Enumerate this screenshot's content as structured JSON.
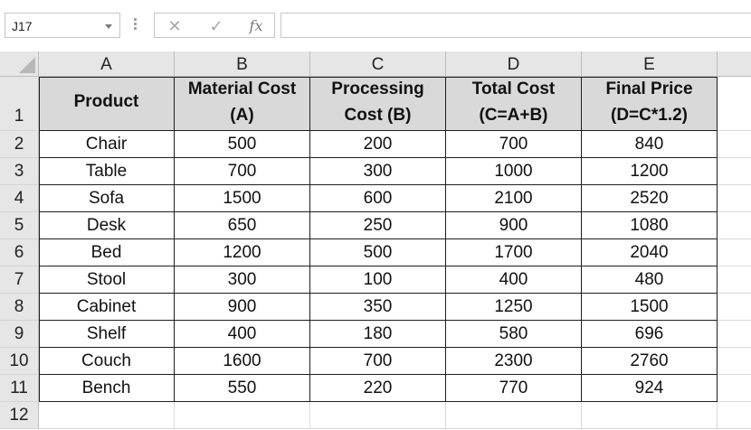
{
  "formula_bar": {
    "name_box": "J17",
    "cancel_glyph": "✕",
    "enter_glyph": "✓",
    "function_glyph": "fx",
    "formula": ""
  },
  "columns": [
    "A",
    "B",
    "C",
    "D",
    "E"
  ],
  "row_numbers": [
    "1",
    "2",
    "3",
    "4",
    "5",
    "6",
    "7",
    "8",
    "9",
    "10",
    "11",
    "12"
  ],
  "headers": [
    {
      "line1": "Product",
      "line2": ""
    },
    {
      "line1": "Material Cost",
      "line2": "(A)"
    },
    {
      "line1": "Processing",
      "line2": "Cost (B)"
    },
    {
      "line1": "Total Cost",
      "line2": "(C=A+B)"
    },
    {
      "line1": "Final Price",
      "line2": "(D=C*1.2)"
    }
  ],
  "rows": [
    [
      "Chair",
      "500",
      "200",
      "700",
      "840"
    ],
    [
      "Table",
      "700",
      "300",
      "1000",
      "1200"
    ],
    [
      "Sofa",
      "1500",
      "600",
      "2100",
      "2520"
    ],
    [
      "Desk",
      "650",
      "250",
      "900",
      "1080"
    ],
    [
      "Bed",
      "1200",
      "500",
      "1700",
      "2040"
    ],
    [
      "Stool",
      "300",
      "100",
      "400",
      "480"
    ],
    [
      "Cabinet",
      "900",
      "350",
      "1250",
      "1500"
    ],
    [
      "Shelf",
      "400",
      "180",
      "580",
      "696"
    ],
    [
      "Couch",
      "1600",
      "700",
      "2300",
      "2760"
    ],
    [
      "Bench",
      "550",
      "220",
      "770",
      "924"
    ]
  ],
  "colors": {
    "header_fill": "#d9d9d9",
    "table_border": "#1e1e1e",
    "gridline": "#d9d9d9",
    "headings_fill": "#e6e6e6"
  }
}
